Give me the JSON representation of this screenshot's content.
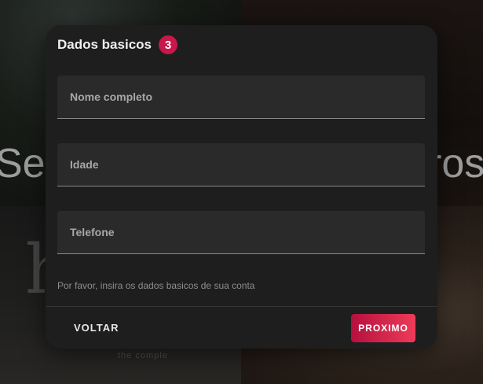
{
  "background": {
    "hero_left": "Seu",
    "hero_right": "ros",
    "poster_left": "h",
    "poster_sub": "the comple"
  },
  "dialog": {
    "title": "Dados basicos",
    "step": "3",
    "fields": [
      {
        "placeholder": "Nome completo",
        "value": ""
      },
      {
        "placeholder": "Idade",
        "value": ""
      },
      {
        "placeholder": "Telefone",
        "value": ""
      }
    ],
    "helper_text": "Por favor, insira os dados basicos de sua conta",
    "back_label": "VOLTAR",
    "next_label": "PROXIMO"
  },
  "colors": {
    "accent": "#c8174a",
    "button_gradient_start": "#b5103f",
    "button_gradient_end": "#ee3b58",
    "dialog_bg": "#1e1e1e",
    "field_bg": "#2a2a2a"
  }
}
